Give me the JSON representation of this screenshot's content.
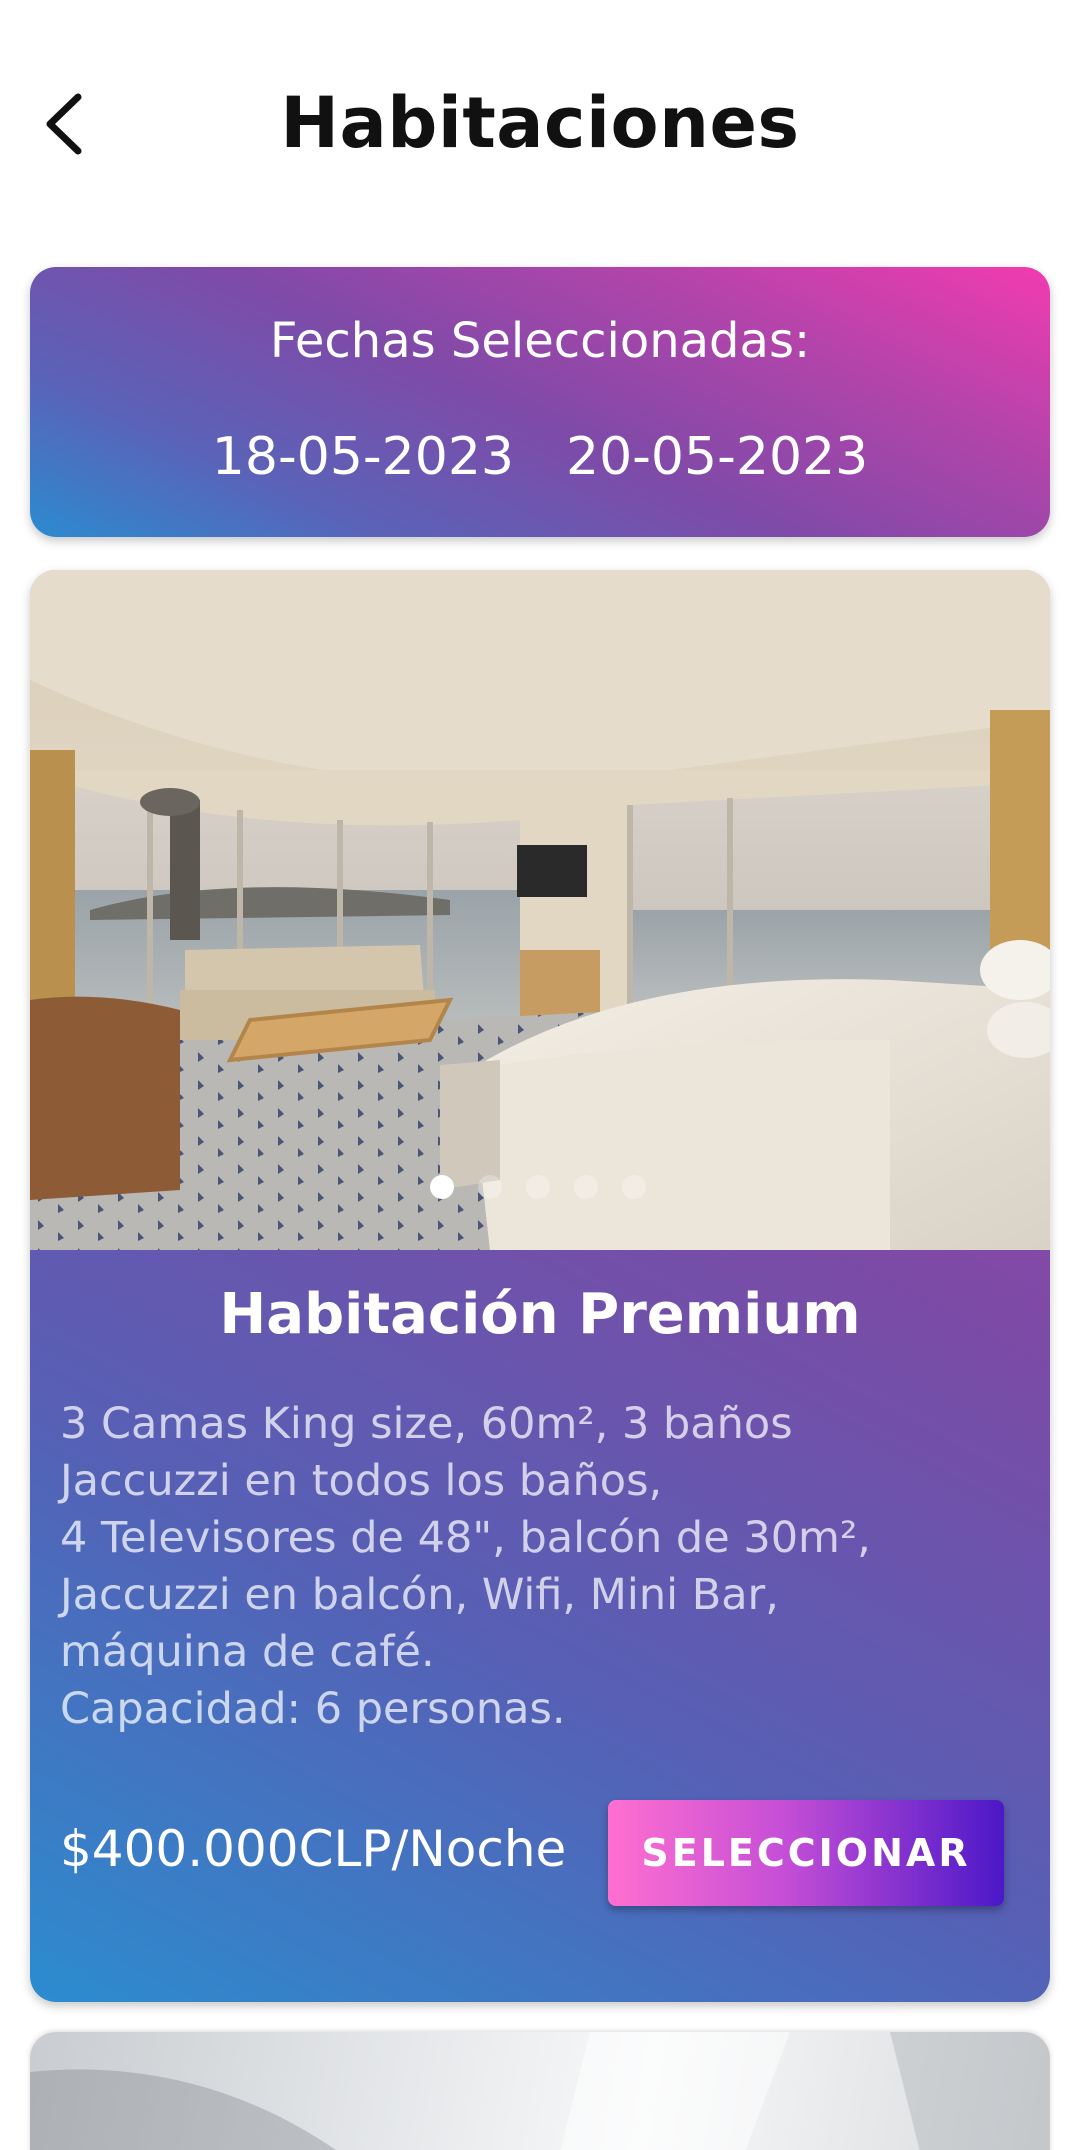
{
  "header": {
    "title": "Habitaciones",
    "back_icon": "chevron-left-icon"
  },
  "dates": {
    "label": "Fechas Seleccionadas:",
    "check_in": "18-05-2023",
    "check_out": "20-05-2023"
  },
  "room": {
    "name": "Habitación Premium",
    "description_lines": [
      "3 Camas King size, 60m², 3 baños",
      "Jaccuzzi en todos los baños,",
      "4 Televisores de 48\", balcón de 30m²,",
      "Jaccuzzi en balcón, Wifi, Mini Bar,",
      "máquina de café.",
      "Capacidad: 6 personas."
    ],
    "price": "$400.000CLP/Noche",
    "select_label": "SELECCIONAR",
    "carousel": {
      "total": 5,
      "active": 1
    }
  },
  "colors": {
    "gradient_start": "#2b8bd0",
    "gradient_mid": "#7f4aa8",
    "gradient_end": "#f23bb0",
    "button_start": "#ff6fd0",
    "button_end": "#4b18c8"
  }
}
